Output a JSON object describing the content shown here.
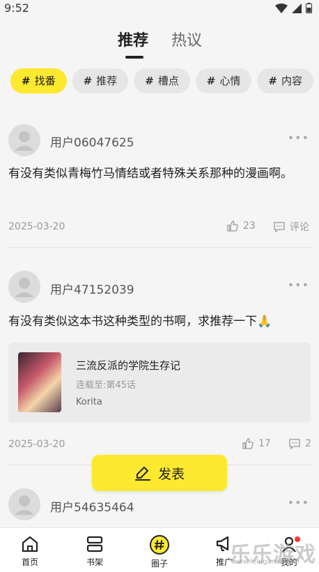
{
  "status": {
    "time": "9:52"
  },
  "top_tabs": [
    {
      "label": "推荐",
      "active": true
    },
    {
      "label": "热议",
      "active": false
    }
  ],
  "chips": [
    {
      "hash": "#",
      "label": "找番",
      "active": true
    },
    {
      "hash": "#",
      "label": "推荐"
    },
    {
      "hash": "#",
      "label": "槽点"
    },
    {
      "hash": "#",
      "label": "心情"
    },
    {
      "hash": "#",
      "label": "内容"
    }
  ],
  "posts": [
    {
      "username": "用户06047625",
      "content": "有没有类似青梅竹马情结或者特殊关系那种的漫画啊。",
      "date": "2025-03-20",
      "likes": "23",
      "comments": "评论"
    },
    {
      "username": "用户47152039",
      "content": "有没有类似这本书这种类型的书啊，求推荐一下🙏",
      "book": {
        "title": "三流反派的学院生存记",
        "progress": "连载至:第45话",
        "author": "Korita"
      },
      "date": "2025-03-20",
      "likes": "17",
      "comments": "2"
    },
    {
      "username": "用户54635464"
    }
  ],
  "publish": {
    "label": "发表"
  },
  "bottom_nav": [
    {
      "label": "首页",
      "icon": "home-icon"
    },
    {
      "label": "书架",
      "icon": "bookshelf-icon"
    },
    {
      "label": "圈子",
      "icon": "circle-hash-icon",
      "active": true
    },
    {
      "label": "推广",
      "icon": "megaphone-icon"
    },
    {
      "label": "我的",
      "icon": "user-icon"
    }
  ],
  "watermark": {
    "text": "乐乐游戏",
    "sub": "www.lelegame.com"
  },
  "colors": {
    "accent": "#fde92f",
    "badge": "#ff3333"
  }
}
